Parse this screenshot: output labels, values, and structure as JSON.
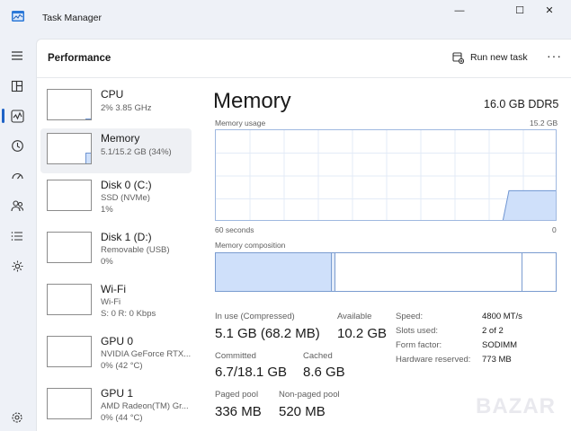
{
  "window": {
    "title": "Task Manager",
    "controls": {
      "minimize": "—",
      "maximize": "☐",
      "close": "✕"
    }
  },
  "header": {
    "title": "Performance",
    "run_new_task": "Run new task",
    "more": "···"
  },
  "devices": [
    {
      "name": "CPU",
      "line1": "2%  3.85 GHz",
      "line2": "",
      "usage": 0.02
    },
    {
      "name": "Memory",
      "line1": "5.1/15.2 GB (34%)",
      "line2": "",
      "usage": 0.34
    },
    {
      "name": "Disk 0 (C:)",
      "line1": "SSD (NVMe)",
      "line2": "1%",
      "usage": 0.01
    },
    {
      "name": "Disk 1 (D:)",
      "line1": "Removable (USB)",
      "line2": "0%",
      "usage": 0
    },
    {
      "name": "Wi-Fi",
      "line1": "Wi-Fi",
      "line2": "S: 0 R: 0 Kbps",
      "usage": 0
    },
    {
      "name": "GPU 0",
      "line1": "NVIDIA GeForce RTX...",
      "line2": "0% (42 °C)",
      "usage": 0
    },
    {
      "name": "GPU 1",
      "line1": "AMD Radeon(TM) Gr...",
      "line2": "0% (44 °C)",
      "usage": 0
    }
  ],
  "memory": {
    "title": "Memory",
    "total": "16.0 GB DDR5",
    "usage_label": "Memory usage",
    "usage_max": "15.2 GB",
    "graph_left": "60 seconds",
    "graph_right": "0",
    "composition_label": "Memory composition",
    "composition": {
      "in_use": 0.34,
      "modified": 0.01,
      "standby": 0.55,
      "free": 0.1
    },
    "stats": {
      "in_use_label": "In use (Compressed)",
      "in_use_value": "5.1 GB (68.2 MB)",
      "available_label": "Available",
      "available_value": "10.2 GB",
      "committed_label": "Committed",
      "committed_value": "6.7/18.1 GB",
      "cached_label": "Cached",
      "cached_value": "8.6 GB",
      "paged_label": "Paged pool",
      "paged_value": "336 MB",
      "nonpaged_label": "Non-paged pool",
      "nonpaged_value": "520 MB"
    },
    "specs": [
      {
        "label": "Speed:",
        "value": "4800 MT/s"
      },
      {
        "label": "Slots used:",
        "value": "2 of 2"
      },
      {
        "label": "Form factor:",
        "value": "SODIMM"
      },
      {
        "label": "Hardware reserved:",
        "value": "773 MB"
      }
    ]
  },
  "watermark": "BAZAR",
  "colors": {
    "accent": "#1f63c6",
    "graph_fill": "#cfe0fa",
    "graph_border": "#7a9cd0",
    "panel": "#ffffff",
    "background": "#eef1f7"
  },
  "icons": [
    "hamburger-icon",
    "processes-icon",
    "performance-icon",
    "app-history-icon",
    "startup-apps-icon",
    "users-icon",
    "details-icon",
    "services-icon",
    "settings-icon",
    "run-task-icon"
  ]
}
